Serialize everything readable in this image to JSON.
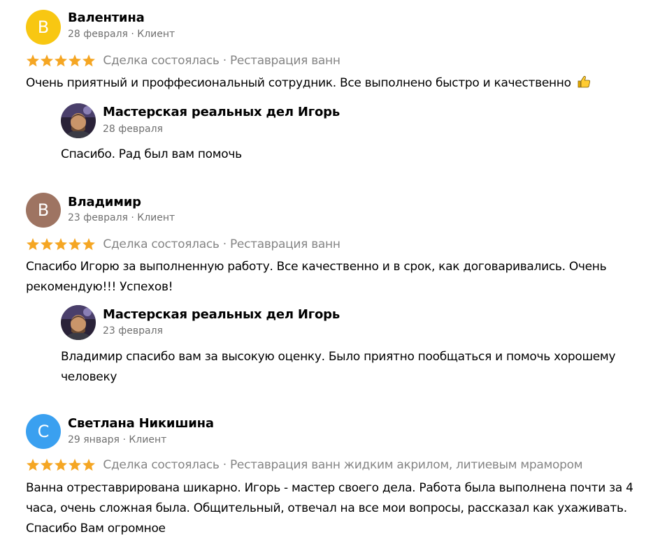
{
  "colors": {
    "star": "#f5a623",
    "meta_text": "#6f6f6f",
    "deal_text": "#858585",
    "avatar_yellow": "#f8c712",
    "avatar_brown": "#9e7462",
    "avatar_blue": "#3aa0f0"
  },
  "reviews": [
    {
      "avatar_letter": "В",
      "author": "Валентина",
      "date": "28 февраля",
      "role": "Клиент",
      "rating": 5,
      "deal_status": "Сделка состоялась",
      "service": "Реставрация ванн",
      "text": "Очень приятный и проффесиональный сотрудник. Все выполнено быстро и качественно",
      "emoji_icon": "thumbs-up-icon",
      "reply": {
        "author": "Мастерская реальных дел Игорь",
        "date": "28 февраля",
        "text": "Спасибо. Рад был вам помочь"
      }
    },
    {
      "avatar_letter": "В",
      "author": "Владимир",
      "date": "23 февраля",
      "role": "Клиент",
      "rating": 5,
      "deal_status": "Сделка состоялась",
      "service": "Реставрация ванн",
      "text": "Спасибо Игорю за выполненную работу. Все качественно и в срок, как договаривались. Очень рекомендую!!! Успехов!",
      "reply": {
        "author": "Мастерская реальных дел Игорь",
        "date": "23 февраля",
        "text": "Владимир спасибо вам за высокую оценку. Было приятно пообщаться и помочь хорошему человеку"
      }
    },
    {
      "avatar_letter": "С",
      "author": "Светлана Никишина",
      "date": "29 января",
      "role": "Клиент",
      "rating": 5,
      "deal_status": "Сделка состоялась",
      "service": "Реставрация ванн жидким акрилом, литиевым мрамором",
      "text": "Ванна отреставрирована шикарно. Игорь - мастер своего дела. Работа была выполнена почти за 4 часа, очень сложная была. Общительный, отвечал на все мои вопросы, рассказал как ухаживать. Спасибо Вам огромное"
    }
  ]
}
